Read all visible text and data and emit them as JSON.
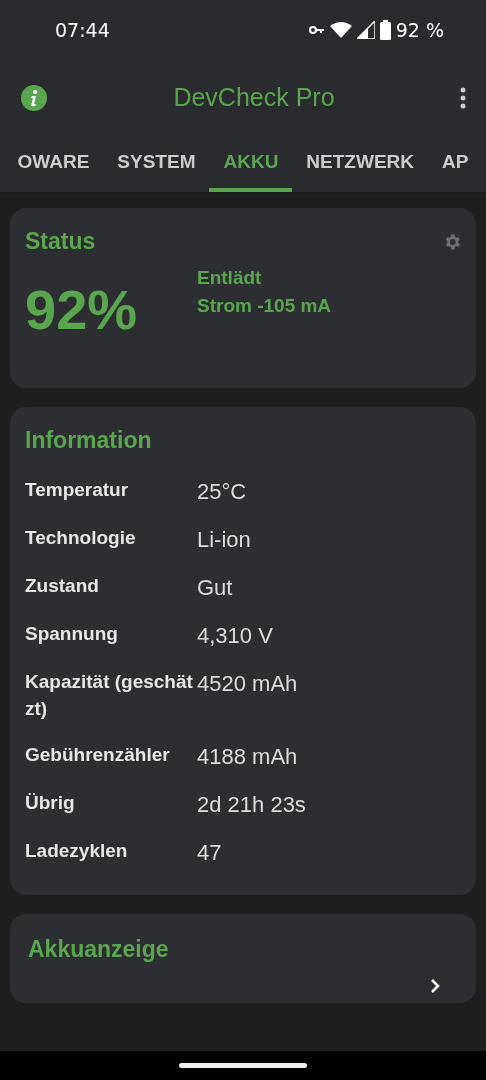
{
  "status_bar": {
    "time": "07:44",
    "battery": "92 %"
  },
  "app_bar": {
    "title": "DevCheck Pro"
  },
  "tabs": [
    {
      "label": "OWARE",
      "selected": false
    },
    {
      "label": "SYSTEM",
      "selected": false
    },
    {
      "label": "AKKU",
      "selected": true
    },
    {
      "label": "NETZWERK",
      "selected": false
    },
    {
      "label": "AP",
      "selected": false
    }
  ],
  "status_card": {
    "title": "Status",
    "percent": "92%",
    "state": "Entlädt",
    "current": "Strom -105 mA"
  },
  "information_card": {
    "title": "Information",
    "rows": [
      {
        "label": "Temperatur",
        "value": "25°C"
      },
      {
        "label": "Technologie",
        "value": "Li-ion"
      },
      {
        "label": "Zustand",
        "value": "Gut"
      },
      {
        "label": "Spannung",
        "value": "4,310 V"
      },
      {
        "label": "Kapazität (geschätzt)",
        "value": "4520 mAh"
      },
      {
        "label": "Gebührenzähler",
        "value": "4188 mAh"
      },
      {
        "label": "Übrig",
        "value": "2d 21h 23s"
      },
      {
        "label": "Ladezyklen",
        "value": "47"
      }
    ]
  },
  "battery_monitor_card": {
    "title": "Akkuanzeige"
  }
}
